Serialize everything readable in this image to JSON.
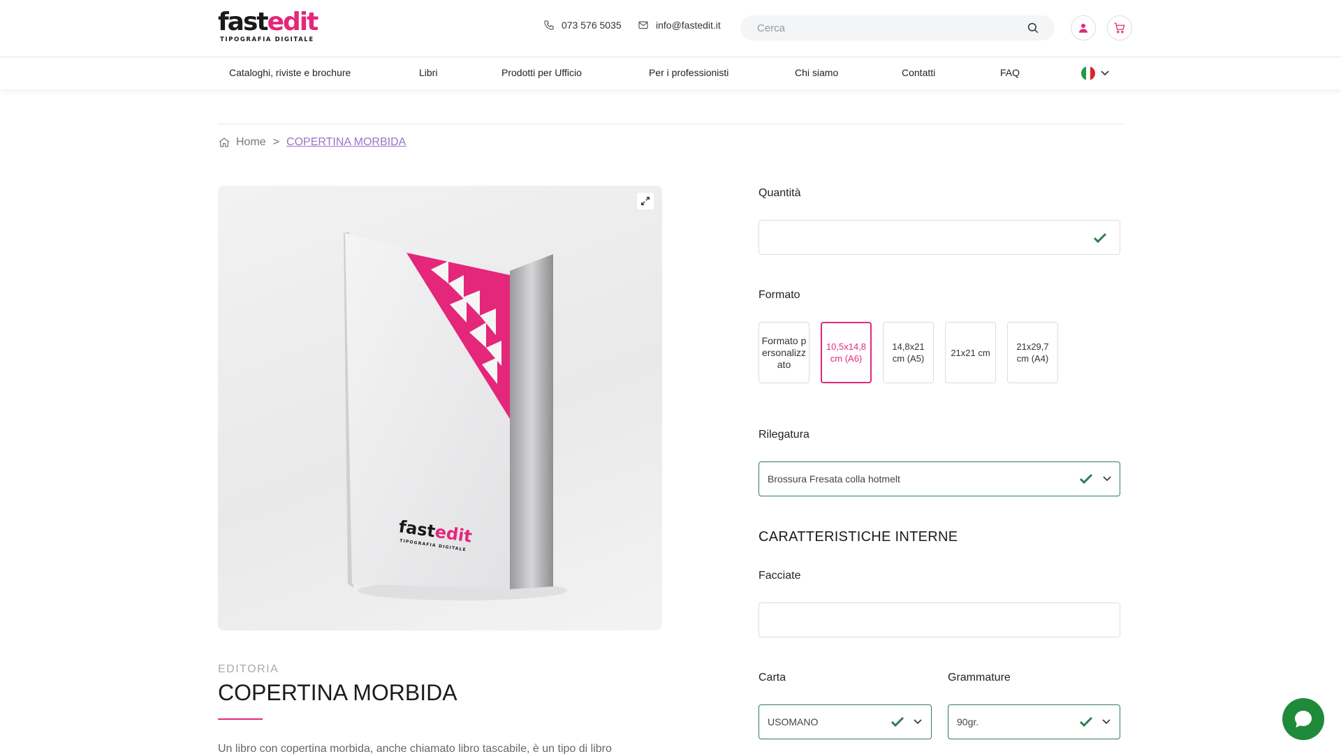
{
  "header": {
    "logo_word_a": "fast",
    "logo_word_b": "edit",
    "logo_sub": "TIPOGRAFIA DIGITALE",
    "phone": "073 576 5035",
    "email": "info@fastedit.it",
    "search_placeholder": "Cerca"
  },
  "nav": {
    "items": [
      "Cataloghi, riviste e brochure",
      "Libri",
      "Prodotti per Ufficio",
      "Per i professionisti",
      "Chi siamo",
      "Contatti",
      "FAQ"
    ]
  },
  "breadcrumb": {
    "home": "Home",
    "separator": ">",
    "current": "COPERTINA MORBIDA"
  },
  "product": {
    "category": "EDITORIA",
    "title": "COPERTINA MORBIDA",
    "description": "Un libro con copertina morbida, anche chiamato libro tascabile, è un tipo di libro",
    "mockup_brand_a": "fast",
    "mockup_brand_b": "edit",
    "mockup_brand_sub": "TIPOGRAFIA DIGITALE"
  },
  "options": {
    "quantita": {
      "label": "Quantità",
      "value": ""
    },
    "formato": {
      "label": "Formato",
      "choices": [
        "Formato personalizzato",
        "10,5x14,8 cm (A6)",
        "14,8x21 cm (A5)",
        "21x21 cm",
        "21x29,7 cm (A4)"
      ],
      "selected_index": 1
    },
    "rilegatura": {
      "label": "Rilegatura",
      "value": "Brossura Fresata colla hotmelt"
    },
    "section_title": "CARATTERISTICHE INTERNE",
    "facciate": {
      "label": "Facciate",
      "value": ""
    },
    "carta": {
      "label": "Carta",
      "value": "USOMANO"
    },
    "grammature": {
      "label": "Grammature",
      "value": "90gr."
    }
  },
  "colors": {
    "brand_pink": "#e4277a",
    "check_green": "#2e7d4f",
    "link_purple": "#9a73c8",
    "chat_green": "#1f8a3a"
  },
  "icons": [
    "phone-icon",
    "mail-icon",
    "search-icon",
    "user-icon",
    "cart-icon",
    "italian-flag-icon",
    "chevron-down-icon",
    "home-icon",
    "expand-icon",
    "check-icon",
    "chat-icon"
  ]
}
